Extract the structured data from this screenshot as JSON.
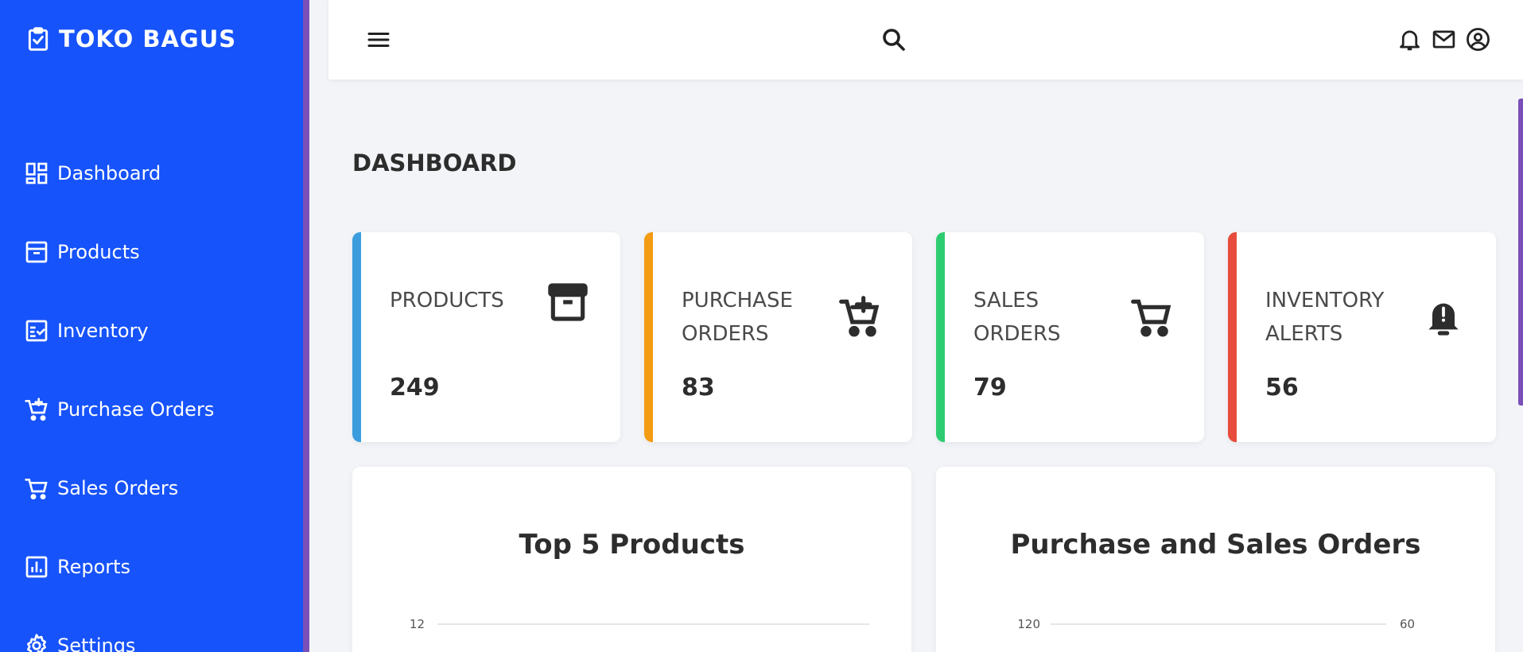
{
  "brand": {
    "title": "TOKO BAGUS"
  },
  "sidebar": {
    "items": [
      {
        "label": "Dashboard",
        "icon": "dashboard-icon"
      },
      {
        "label": "Products",
        "icon": "archive-icon"
      },
      {
        "label": "Inventory",
        "icon": "checklist-icon"
      },
      {
        "label": "Purchase Orders",
        "icon": "cart-plus-icon"
      },
      {
        "label": "Sales Orders",
        "icon": "cart-icon"
      },
      {
        "label": "Reports",
        "icon": "bar-report-icon"
      },
      {
        "label": "Settings",
        "icon": "gear-icon"
      }
    ]
  },
  "topbar": {
    "icons": [
      "menu-icon",
      "search-icon",
      "bell-icon",
      "mail-icon",
      "account-icon"
    ]
  },
  "page": {
    "title": "DASHBOARD"
  },
  "stats": [
    {
      "label": "PRODUCTS",
      "value": "249",
      "color": "#3b9ddd",
      "icon": "archive-icon"
    },
    {
      "label": "PURCHASE ORDERS",
      "value": "83",
      "color": "#f39c12",
      "icon": "cart-plus-icon"
    },
    {
      "label": "SALES ORDERS",
      "value": "79",
      "color": "#2ecc71",
      "icon": "cart-icon"
    },
    {
      "label": "INVENTORY ALERTS",
      "value": "56",
      "color": "#e74c3c",
      "icon": "bell-alert-icon"
    }
  ],
  "colors": {
    "sidebar": "#1753fa",
    "accent": "#7a4fb8",
    "background": "#f2f4f8"
  },
  "charts": [
    {
      "title": "Top 5 Products",
      "ytick_left": "12"
    },
    {
      "title": "Purchase and Sales Orders",
      "ytick_left": "120",
      "ytick_right": "60"
    }
  ],
  "chart_data": [
    {
      "type": "bar",
      "title": "Top 5 Products",
      "yticks_visible": [
        12
      ],
      "categories": [],
      "values": []
    },
    {
      "type": "bar",
      "title": "Purchase and Sales Orders",
      "yticks_left_visible": [
        120
      ],
      "yticks_right_visible": [
        60
      ],
      "categories": [],
      "series": []
    }
  ]
}
